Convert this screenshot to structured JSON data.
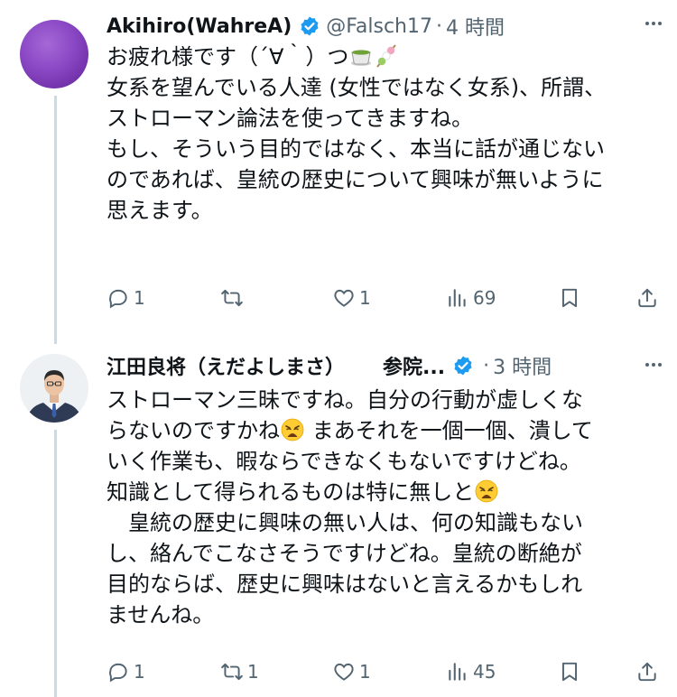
{
  "tweets": [
    {
      "author_name": "Akihiro(WahreA)",
      "handle": "@Falsch17",
      "separator": "·",
      "time": "4 時間",
      "body_line1": "お疲れ様です（´∀｀）つ",
      "body_rest": "\n女系を望んでいる人達 (女性ではなく女系)、所謂、\nストローマン論法を使ってきますね。\nもし、そういう目的ではなく、本当に話が通じない\nのであれば、皇統の歴史について興味が無いように\n思えます。",
      "emojis": [
        "green-tea-emoji",
        "dango-emoji"
      ],
      "replies": "1",
      "reposts": "",
      "likes": "1",
      "views": "69",
      "avatar": "purple-avatar"
    },
    {
      "author_name": "江田良将（えだよしまさ）",
      "author_suffix": "参院...",
      "separator": "·",
      "time": "3 時間",
      "body_part1": "ストローマン三昧ですね。自分の行動が虚しくな\nらないのですかね",
      "body_part2": " まあそれを一個一個、潰して\nいく作業も、暇ならできなくもないですけどね。\n知識として得られるものは特に無しと",
      "body_part3": "\n　皇統の歴史に興味の無い人は、何の知識もない\nし、絡んでこなさそうですけどね。皇統の断絶が\n目的ならば、歴史に興味はないと言えるかもしれ\nませんね。",
      "emojis": [
        "weary-face-emoji",
        "weary-face-emoji"
      ],
      "replies": "1",
      "reposts": "1",
      "likes": "1",
      "views": "45",
      "avatar": "man-in-suit-avatar"
    }
  ],
  "colors": {
    "text": "#0f1419",
    "secondary": "#536471",
    "verified": "#1d9bf0",
    "thread_line": "#cfd9de"
  },
  "icons": [
    "verified-badge-icon",
    "more-icon",
    "reply-icon",
    "repost-icon",
    "like-icon",
    "views-icon",
    "bookmark-icon",
    "share-icon"
  ]
}
